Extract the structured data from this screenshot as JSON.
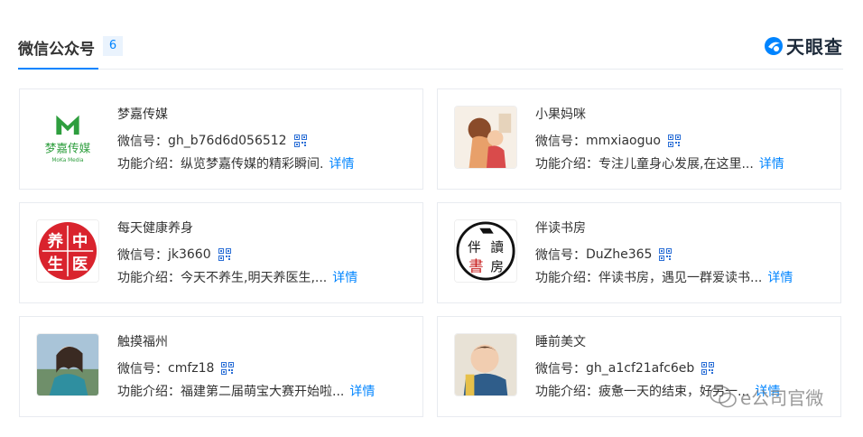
{
  "section": {
    "title": "微信公众号",
    "count": "6",
    "brand_name": "天眼查"
  },
  "labels": {
    "wechat_id_prefix": "微信号：",
    "intro_prefix": "功能介绍：",
    "detail_link": "详情"
  },
  "accounts": [
    {
      "name": "梦嘉传媒",
      "wechat_id": "gh_b76d6d056512",
      "intro": "纵览梦嘉传媒的精彩瞬间.",
      "avatar_text": "梦嘉传媒",
      "avatar_subtext": "MoKa Media"
    },
    {
      "name": "小果妈咪",
      "wechat_id": "mmxiaoguo",
      "intro": "专注儿童身心发展,在这里..."
    },
    {
      "name": "每天健康养身",
      "wechat_id": "jk3660",
      "intro": "今天不养生,明天养医生,...",
      "avatar_chars": [
        "养",
        "中",
        "生",
        "医"
      ]
    },
    {
      "name": "伴读书房",
      "wechat_id": "DuZhe365",
      "intro": "伴读书房，遇见一群爱读书...",
      "avatar_chars": [
        "伴",
        "讀",
        "書",
        "房"
      ]
    },
    {
      "name": "触摸福州",
      "wechat_id": "cmfz18",
      "intro": "福建第二届萌宝大赛开始啦..."
    },
    {
      "name": "睡前美文",
      "wechat_id": "gh_a1cf21afc6eb",
      "intro": "疲惫一天的结束，好另一..."
    }
  ],
  "watermark": {
    "text": "e公司官微"
  },
  "colors": {
    "accent": "#0084ff",
    "border": "#e8ebf0",
    "badge_bg": "#eaf3fd",
    "seal_red": "#d9232d",
    "moka_green": "#2e9e3e"
  }
}
